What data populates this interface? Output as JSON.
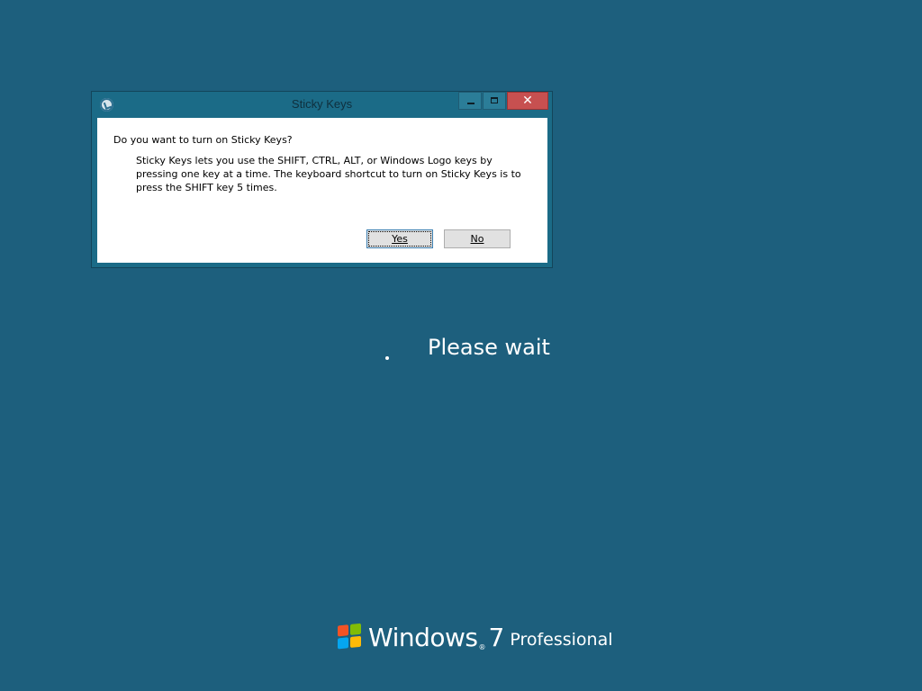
{
  "dialog": {
    "title": "Sticky Keys",
    "question": "Do you want to turn on Sticky Keys?",
    "description": "Sticky Keys lets you use the SHIFT, CTRL, ALT, or Windows Logo keys by pressing one key at a time. The keyboard shortcut to turn on Sticky Keys is to press the SHIFT key 5 times.",
    "buttons": {
      "yes": "Yes",
      "no": "No"
    },
    "controls": {
      "close_glyph": "✕"
    }
  },
  "status": {
    "text": "Please wait"
  },
  "branding": {
    "product": "Windows",
    "trademark": "®",
    "version": "7",
    "edition": "Professional"
  },
  "colors": {
    "desktop_bg": "#1d5f7d",
    "close_button": "#c75050"
  },
  "icons": {
    "dialog_icon": "ease-of-access-icon",
    "logo": "windows-flag-logo"
  }
}
